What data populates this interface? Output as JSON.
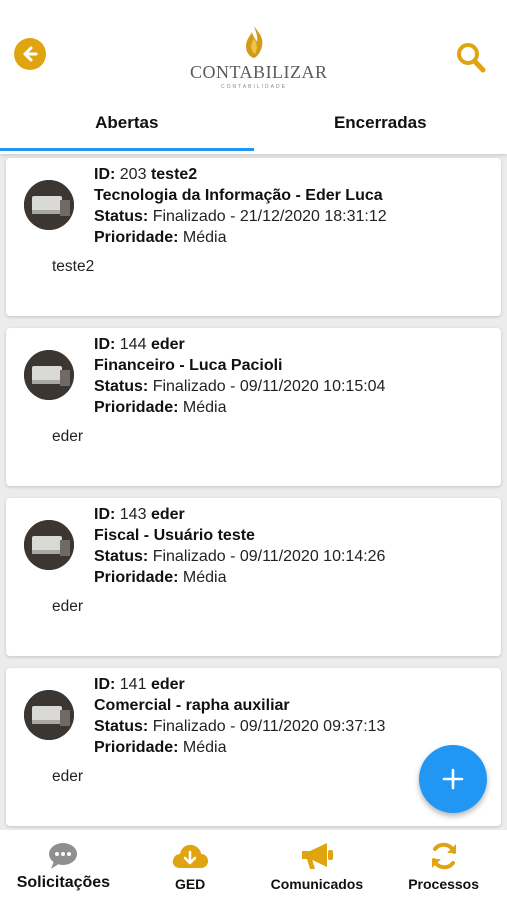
{
  "colors": {
    "accent": "#e0a410",
    "primary": "#2196f3",
    "background": "#ececec"
  },
  "header": {
    "back_icon": "arrow-left-icon",
    "search_icon": "search-icon",
    "logo_title": "CONTABILIZAR",
    "logo_sub": "CONTABILIDADE"
  },
  "tabs": [
    {
      "label": "Abertas",
      "active": true
    },
    {
      "label": "Encerradas",
      "active": false
    }
  ],
  "labels": {
    "id": "ID:",
    "status": "Status:",
    "priority": "Prioridade:"
  },
  "tickets": [
    {
      "id": "203",
      "title": "teste2",
      "department": "Tecnologia da Informação - Eder Luca",
      "status": "Finalizado - 21/12/2020 18:31:12",
      "priority": "Média",
      "description": "teste2"
    },
    {
      "id": "144",
      "title": "eder",
      "department": "Financeiro - Luca Pacioli",
      "status": "Finalizado - 09/11/2020 10:15:04",
      "priority": "Média",
      "description": "eder"
    },
    {
      "id": "143",
      "title": "eder",
      "department": "Fiscal - Usuário teste",
      "status": "Finalizado - 09/11/2020 10:14:26",
      "priority": "Média",
      "description": "eder"
    },
    {
      "id": "141",
      "title": "eder",
      "department": "Comercial - rapha auxiliar",
      "status": "Finalizado - 09/11/2020 09:37:13",
      "priority": "Média",
      "description": "eder"
    }
  ],
  "fab": {
    "icon": "plus-icon",
    "label": "+"
  },
  "bottom_nav": [
    {
      "label": "Solicitações",
      "icon": "chat-bubble-icon",
      "active": true
    },
    {
      "label": "GED",
      "icon": "cloud-download-icon",
      "active": false
    },
    {
      "label": "Comunicados",
      "icon": "megaphone-icon",
      "active": false
    },
    {
      "label": "Processos",
      "icon": "refresh-icon",
      "active": false
    }
  ]
}
